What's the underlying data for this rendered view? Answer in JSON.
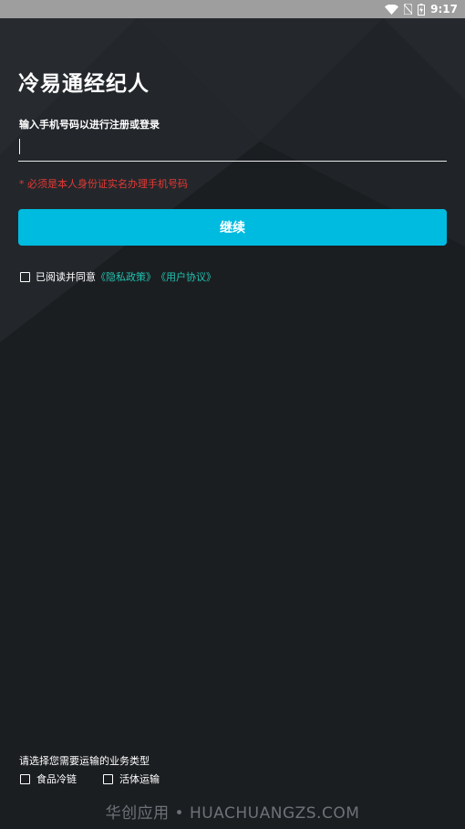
{
  "status_bar": {
    "time": "9:17",
    "icons": [
      "wifi-icon",
      "no-sim-icon",
      "battery-icon"
    ]
  },
  "header": {
    "title": "冷易通经纪人"
  },
  "login": {
    "phone_label": "输入手机号码以进行注册或登录",
    "phone_value": "",
    "warning": "* 必须是本人身份证实名办理手机号码",
    "continue_label": "继续"
  },
  "agreement": {
    "prefix": "已阅读并同意",
    "privacy_link": "《隐私政策》",
    "user_link": "《用户协议》",
    "checked": false
  },
  "business": {
    "label": "请选择您需要运输的业务类型",
    "options": [
      {
        "label": "食品冷链",
        "checked": false
      },
      {
        "label": "活体运输",
        "checked": false
      }
    ]
  },
  "watermark": "华创应用 • HUACHUANGZS.COM",
  "colors": {
    "background": "#1b1e21",
    "accent": "#00bbe0",
    "link": "#1fc2b0",
    "warning": "#e53935"
  }
}
